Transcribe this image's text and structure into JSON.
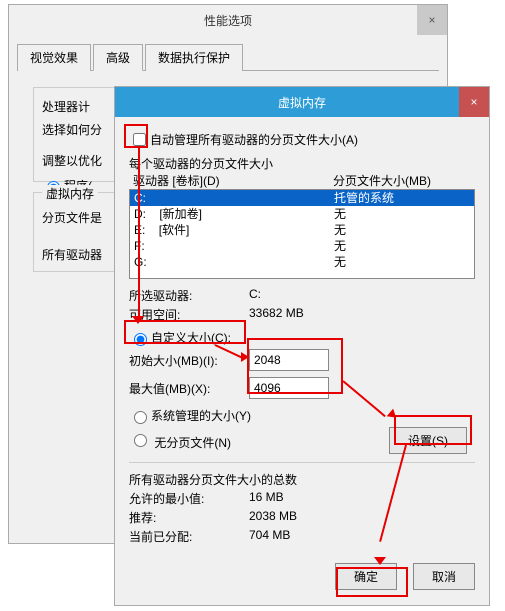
{
  "perf_dialog": {
    "title": "性能选项",
    "close": "×",
    "tabs": {
      "visual": "视觉效果",
      "advanced": "高级",
      "dep": "数据执行保护"
    },
    "processor_label": "处理器计",
    "select_how_label": "选择如何分",
    "adjust_label": "调整以优化",
    "program_label": "程序(",
    "vm_group": "虚拟内存",
    "paging_label": "分页文件是",
    "all_drives_label": "所有驱动器"
  },
  "vm_dialog": {
    "title": "虚拟内存",
    "close": "×",
    "auto_manage": "自动管理所有驱动器的分页文件大小(A)",
    "each_drive_label": "每个驱动器的分页文件大小",
    "list_header": {
      "drive": "驱动器 [卷标](D)",
      "size": "分页文件大小(MB)"
    },
    "drives": [
      {
        "d": "C:",
        "v": "",
        "s": "托管的系统"
      },
      {
        "d": "D:",
        "v": "[新加卷]",
        "s": "无"
      },
      {
        "d": "E:",
        "v": "[软件]",
        "s": "无"
      },
      {
        "d": "F:",
        "v": "",
        "s": "无"
      },
      {
        "d": "G:",
        "v": "",
        "s": "无"
      }
    ],
    "selected_drive_label": "所选驱动器:",
    "selected_drive": "C:",
    "available_label": "可用空间:",
    "available": "33682 MB",
    "custom_size": "自定义大小(C):",
    "initial_label": "初始大小(MB)(I):",
    "initial_value": "2048",
    "max_label": "最大值(MB)(X):",
    "max_value": "4096",
    "system_managed": "系统管理的大小(Y)",
    "no_paging": "无分页文件(N)",
    "set_btn": "设置(S)",
    "totals_label": "所有驱动器分页文件大小的总数",
    "min_label": "允许的最小值:",
    "min_value": "16 MB",
    "rec_label": "推荐:",
    "rec_value": "2038 MB",
    "cur_label": "当前已分配:",
    "cur_value": "704 MB",
    "ok": "确定",
    "cancel": "取消"
  }
}
